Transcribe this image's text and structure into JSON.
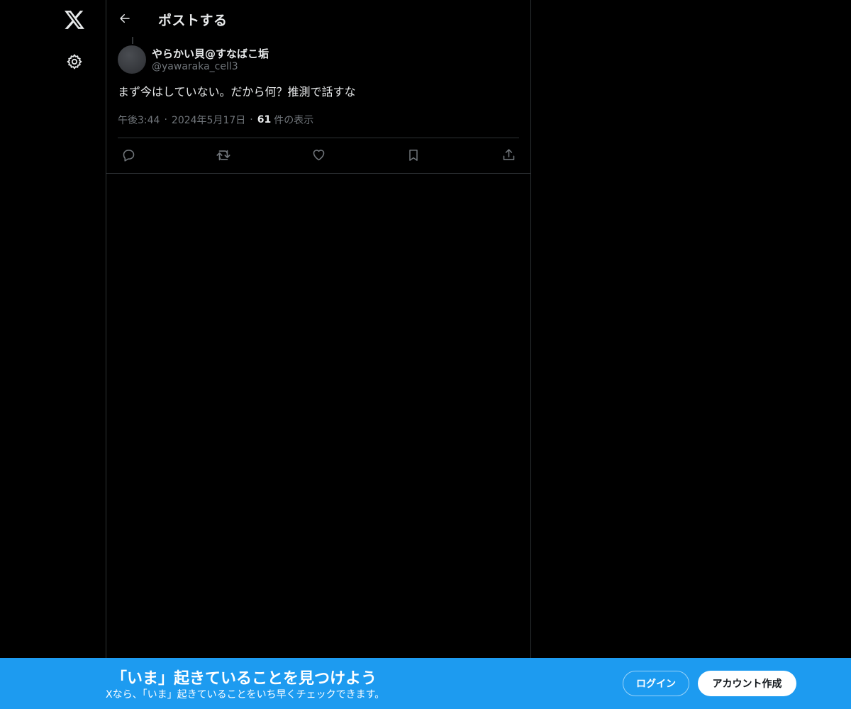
{
  "header": {
    "title": "ポストする"
  },
  "post": {
    "author_name": "やらかい貝@すなばこ垢",
    "author_handle": "@yawaraka_cell3",
    "text": "まず今はしていない。だから何？推測で話すな",
    "time": "午後3:44",
    "date": "2024年5月17日",
    "views_count": "61",
    "views_label": "件の表示",
    "separator": "·"
  },
  "banner": {
    "title": "「いま」起きていることを見つけよう",
    "subtitle": "Xなら、「いま」起きていることをいち早くチェックできます。",
    "login_label": "ログイン",
    "signup_label": "アカウント作成"
  },
  "colors": {
    "background": "#000000",
    "text_primary": "#e7e9ea",
    "text_secondary": "#71767b",
    "border": "#2f3336",
    "banner": "#1d9bf0"
  },
  "icons": {
    "logo": "x-logo-icon",
    "settings": "gear-icon",
    "back": "arrow-left-icon",
    "reply": "reply-icon",
    "repost": "repost-icon",
    "like": "heart-icon",
    "bookmark": "bookmark-icon",
    "share": "share-icon"
  }
}
